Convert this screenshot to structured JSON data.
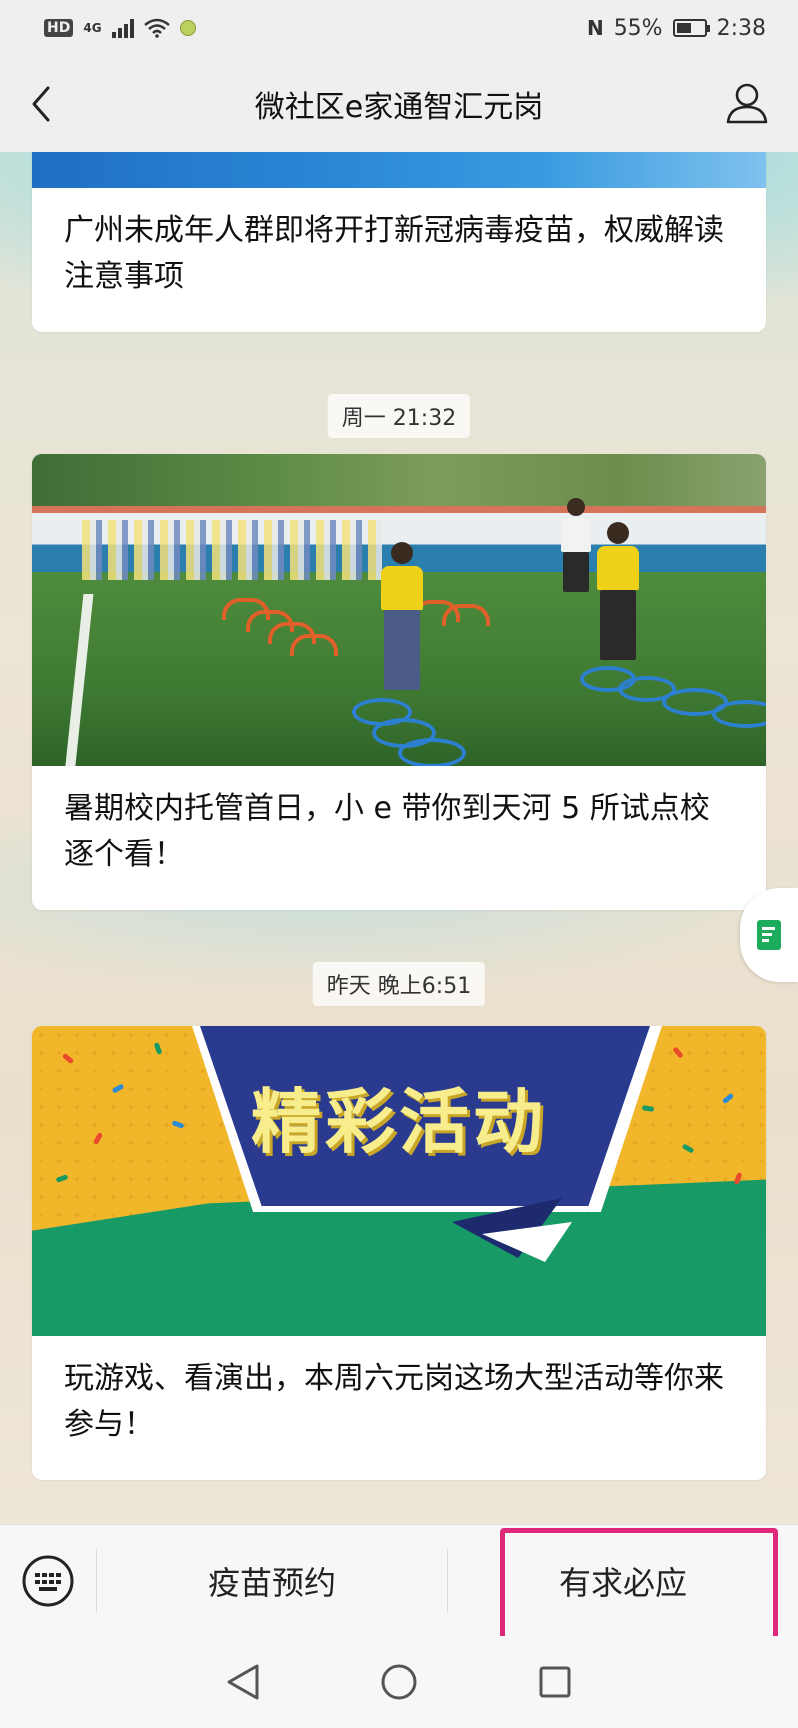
{
  "status_bar": {
    "hd": "HD",
    "network": "4G",
    "nfc": "N",
    "battery_percent": "55%",
    "battery_level": 0.55,
    "time": "2:38"
  },
  "header": {
    "title": "微社区e家通智汇元岗",
    "back_icon": "chevron-left-icon",
    "profile_icon": "user-icon"
  },
  "feed": {
    "articles": [
      {
        "caption": "广州未成年人群即将开打新冠病毒疫苗，权威解读注意事项"
      },
      {
        "timestamp": "周一 21:32",
        "caption": "暑期校内托管首日，小 e 带你到天河 5 所试点校逐个看！"
      },
      {
        "timestamp": "昨天 晚上6:51",
        "banner_text": "精彩活动",
        "caption": "玩游戏、看演出，本周六元岗这场大型活动等你来参与！"
      }
    ]
  },
  "bottom_menu": {
    "keyboard_icon": "keyboard-icon",
    "items": [
      {
        "label": "疫苗预约"
      },
      {
        "label": "有求必应",
        "highlighted": true
      }
    ],
    "highlight_color": "#e0287a"
  },
  "nav_bar": {
    "icons": [
      "back-triangle-icon",
      "home-circle-icon",
      "recents-square-icon"
    ]
  }
}
